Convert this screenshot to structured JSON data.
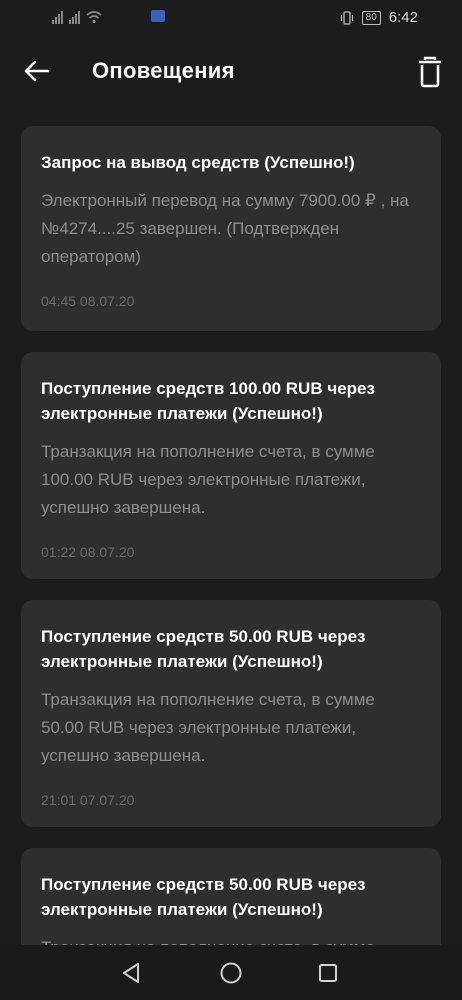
{
  "status": {
    "time": "6:42",
    "battery": "80"
  },
  "header": {
    "title": "Оповещения"
  },
  "notifications": [
    {
      "title": "Запрос на вывод средств (Успешно!)",
      "body": "Электронный перевод на сумму 7900.00 ₽ , на №4274....25  завершен. (Подтвержден оператором)",
      "time": "04:45 08.07.20"
    },
    {
      "title": "Поступление средств 100.00 RUB через электронные платежи (Успешно!)",
      "body": "Транзакция на пополнение счета, в сумме 100.00 RUB через электронные платежи, успешно завершена.",
      "time": "01:22 08.07.20"
    },
    {
      "title": "Поступление средств 50.00 RUB через электронные платежи (Успешно!)",
      "body": "Транзакция на пополнение счета, в сумме 50.00 RUB через электронные платежи, успешно завершена.",
      "time": "21:01 07.07.20"
    },
    {
      "title": "Поступление средств 50.00 RUB через электронные платежи (Успешно!)",
      "body": "Транзакция на пополнение счета, в сумме",
      "time": ""
    }
  ],
  "colors": {
    "background": "#1c1c1c",
    "card": "#2e2e2e",
    "title_text": "#ffffff",
    "body_text": "#8e8e8e",
    "time_text": "#6b6b6b"
  },
  "icons": {
    "back": "arrow-left-icon",
    "delete": "trash-icon",
    "nav_back": "triangle-back-icon",
    "nav_home": "circle-home-icon",
    "nav_recent": "square-recent-icon"
  }
}
